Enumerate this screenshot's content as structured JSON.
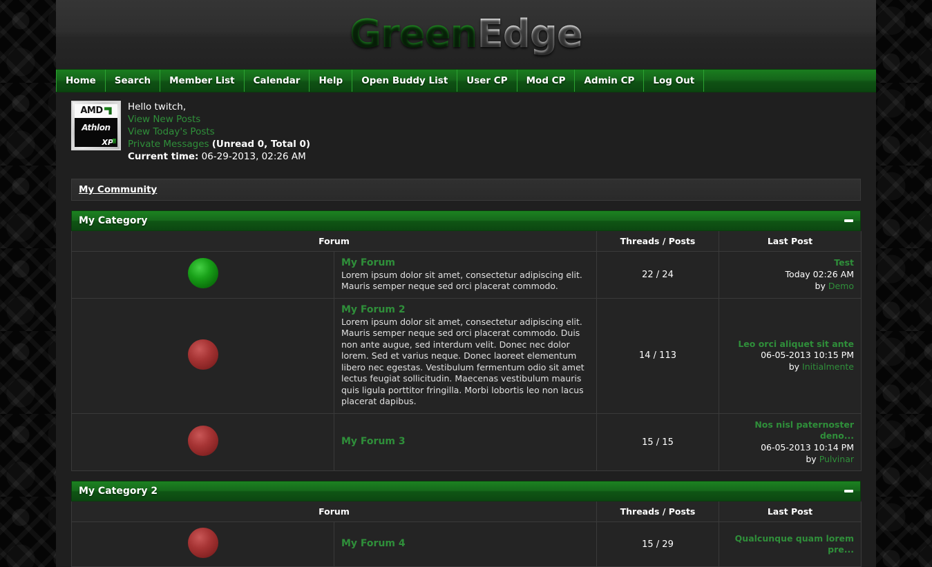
{
  "site": {
    "logo_green": "Green",
    "logo_edge": "Edge"
  },
  "nav": {
    "items": [
      {
        "label": "Home",
        "name": "nav-home"
      },
      {
        "label": "Search",
        "name": "nav-search"
      },
      {
        "label": "Member List",
        "name": "nav-member-list"
      },
      {
        "label": "Calendar",
        "name": "nav-calendar"
      },
      {
        "label": "Help",
        "name": "nav-help"
      },
      {
        "label": "Open Buddy List",
        "name": "nav-open-buddy-list"
      },
      {
        "label": "User CP",
        "name": "nav-user-cp"
      },
      {
        "label": "Mod CP",
        "name": "nav-mod-cp"
      },
      {
        "label": "Admin CP",
        "name": "nav-admin-cp"
      },
      {
        "label": "Log Out",
        "name": "nav-log-out"
      }
    ]
  },
  "welcome": {
    "greeting": "Hello twitch,",
    "view_new_posts": "View New Posts",
    "view_todays_posts": "View Today's Posts",
    "private_messages": "Private Messages",
    "pm_counts": "(Unread 0, Total 0)",
    "current_time_label": "Current time:",
    "current_time_value": "06-29-2013, 02:26 AM",
    "avatar": {
      "brand": "AMD",
      "model": "Athlon",
      "model_sub": "",
      "series": "XP"
    }
  },
  "breadcrumb": {
    "text": "My Community"
  },
  "columns": {
    "forum": "Forum",
    "threads_posts": "Threads / Posts",
    "last_post": "Last Post"
  },
  "categories": [
    {
      "title": "My Category",
      "forums": [
        {
          "icon": "forum-icon-new",
          "icon_color": "green",
          "name": "My Forum",
          "description": "Lorem ipsum dolor sit amet, consectetur adipiscing elit. Mauris semper neque sed orci placerat commodo.",
          "threads_posts": "22 / 24",
          "last_post_title": "Test",
          "last_post_date": "Today 02:26 AM",
          "last_post_by_label": "by",
          "last_post_user": "Demo"
        },
        {
          "icon": "forum-icon-read",
          "icon_color": "red",
          "name": "My Forum 2",
          "description": "Lorem ipsum dolor sit amet, consectetur adipiscing elit. Mauris semper neque sed orci placerat commodo. Duis non ante augue, sed interdum velit. Donec nec dolor lorem. Sed et varius neque. Donec laoreet elementum libero nec egestas. Vestibulum fermentum odio sit amet lectus feugiat sollicitudin. Maecenas vestibulum mauris quis ligula porttitor fringilla. Morbi lobortis leo non lacus placerat dapibus.",
          "threads_posts": "14 / 113",
          "last_post_title": "Leo orci aliquet sit ante",
          "last_post_date": "06-05-2013 10:15 PM",
          "last_post_by_label": "by",
          "last_post_user": "Initialmente"
        },
        {
          "icon": "forum-icon-read",
          "icon_color": "red",
          "name": "My Forum 3",
          "description": "",
          "threads_posts": "15 / 15",
          "last_post_title": "Nos nisl paternoster deno...",
          "last_post_date": "06-05-2013 10:14 PM",
          "last_post_by_label": "by",
          "last_post_user": "Pulvinar"
        }
      ]
    },
    {
      "title": "My Category 2",
      "forums": [
        {
          "icon": "forum-icon-read",
          "icon_color": "red",
          "name": "My Forum 4",
          "description": "",
          "threads_posts": "15 / 29",
          "last_post_title": "Qualcunque quam lorem pre...",
          "last_post_date": "",
          "last_post_by_label": "",
          "last_post_user": ""
        }
      ]
    }
  ],
  "colors": {
    "accent_green": "#2f8f3a",
    "header_green": "#16691b",
    "panel_bg": "#242424",
    "page_bg": "#1f1f1f"
  }
}
